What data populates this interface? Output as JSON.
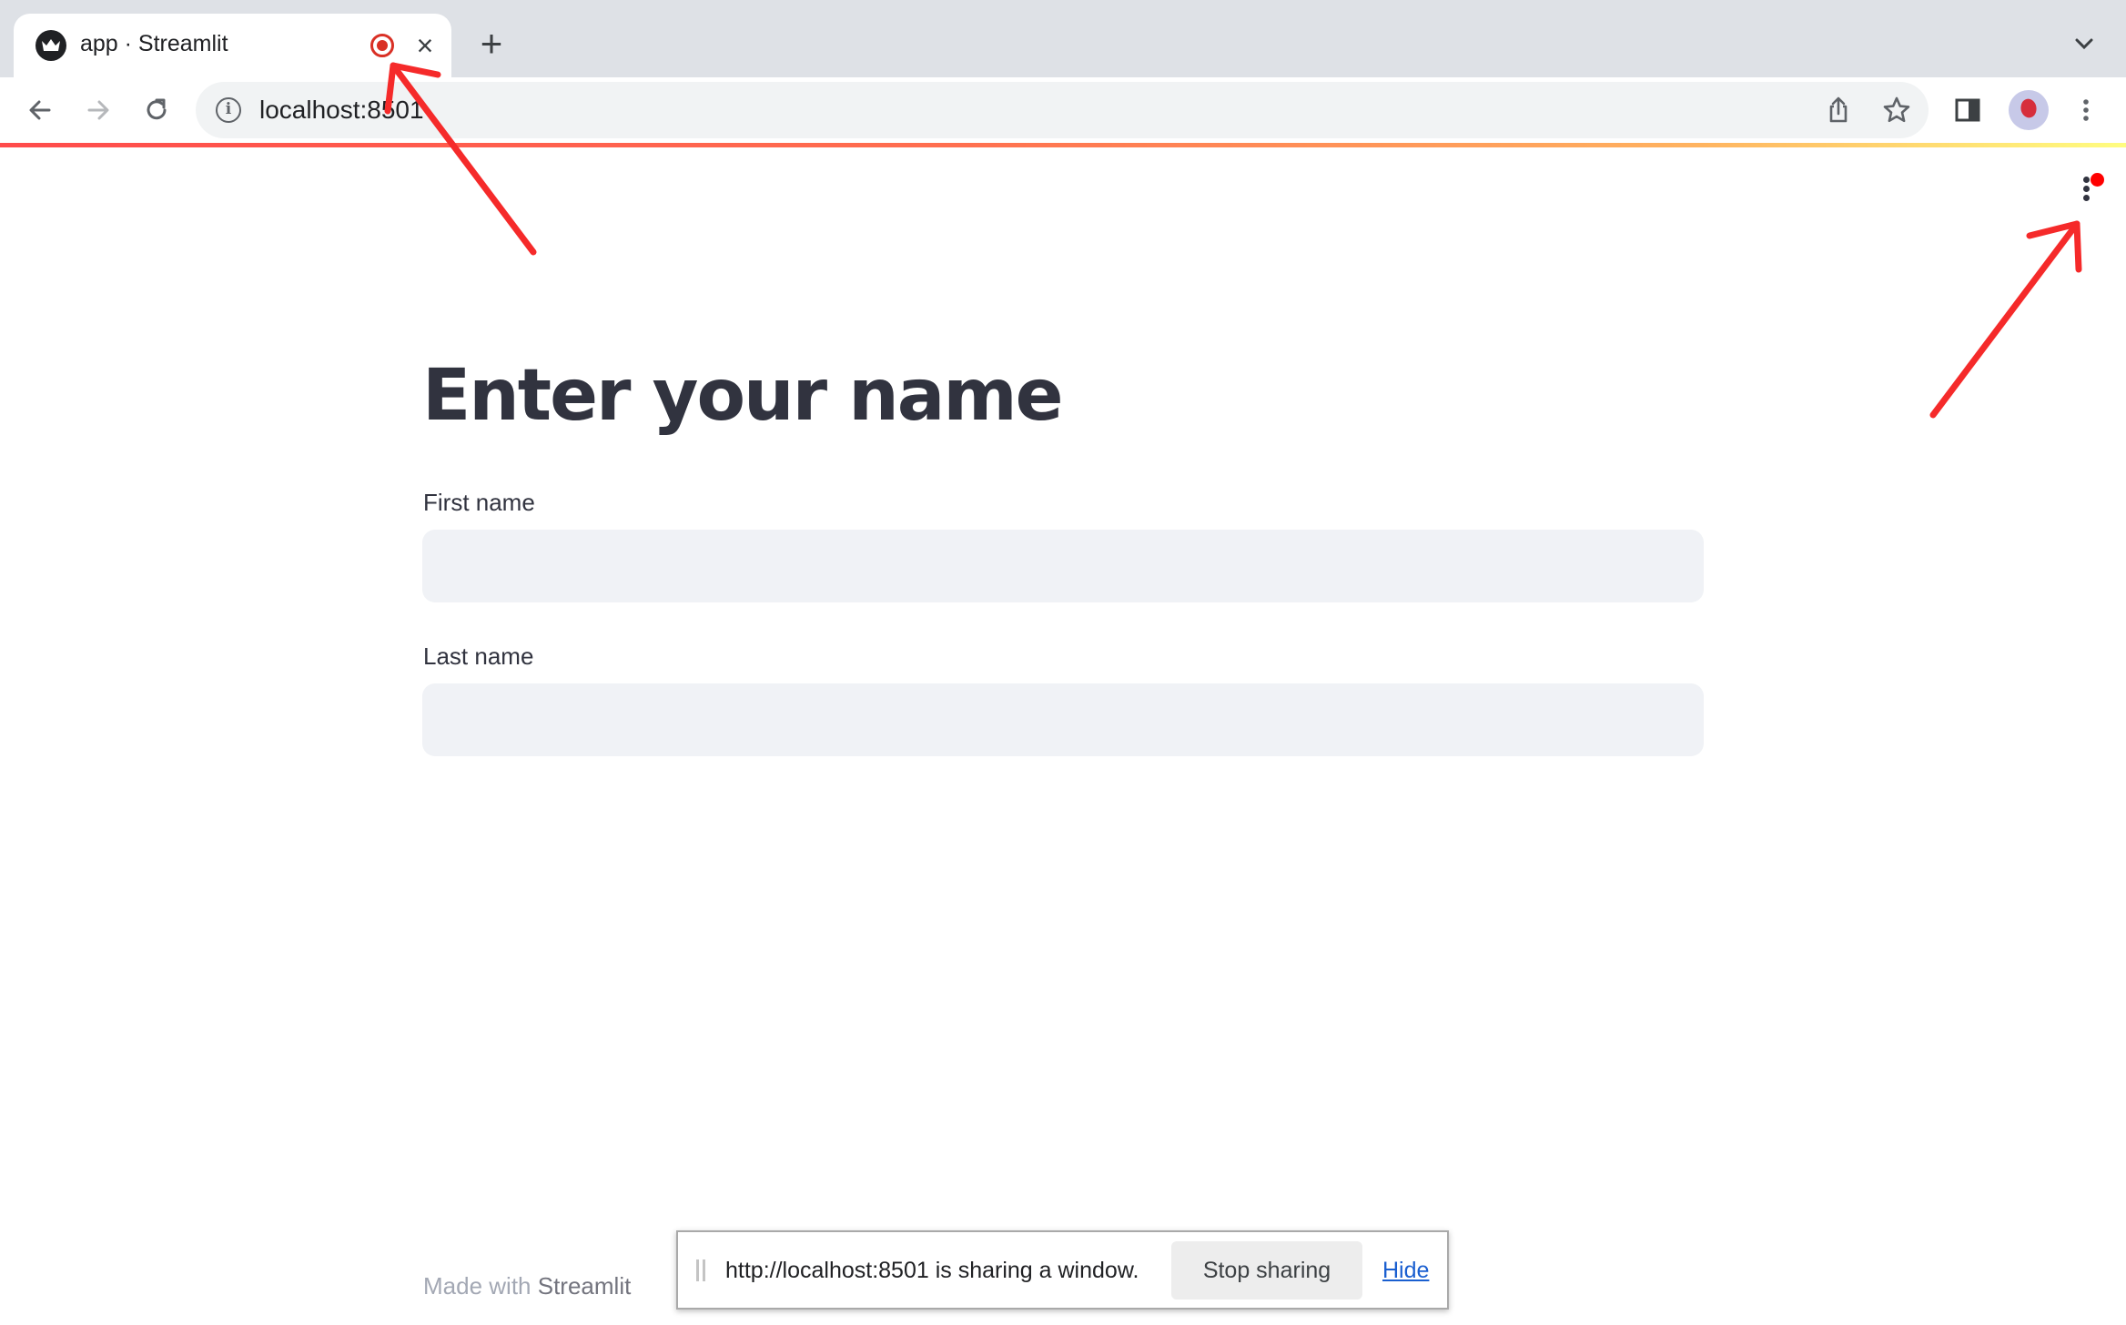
{
  "browser": {
    "tab": {
      "title": "app · Streamlit",
      "favicon": "streamlit-crown-icon",
      "recording_indicator": "recording-icon",
      "close_icon": "close-icon"
    },
    "new_tab_icon": "plus-icon",
    "tab_list_icon": "chevron-down-icon",
    "toolbar": {
      "back_icon": "arrow-left-icon",
      "forward_icon": "arrow-right-icon",
      "reload_icon": "reload-icon",
      "site_info_icon": "info-icon",
      "url": "localhost:8501",
      "share_icon": "share-icon",
      "bookmark_icon": "star-icon",
      "side_panel_icon": "side-panel-icon",
      "profile_icon": "profile-avatar",
      "menu_icon": "kebab-menu-icon"
    },
    "loading_gradient": [
      "#ff4b4b",
      "#ffb460",
      "#fffd80"
    ]
  },
  "app": {
    "menu_icon": "kebab-menu-icon",
    "menu_notification_color": "#ff0000",
    "title": "Enter your name",
    "fields": [
      {
        "label": "First name",
        "value": "",
        "placeholder": ""
      },
      {
        "label": "Last name",
        "value": "",
        "placeholder": ""
      }
    ],
    "footer": {
      "prefix": "Made with ",
      "brand": "Streamlit"
    }
  },
  "sharing_bar": {
    "message": "http://localhost:8501 is sharing a window.",
    "stop_label": "Stop sharing",
    "hide_label": "Hide"
  },
  "annotations": {
    "arrow_color": "#f52a2a",
    "arrows": [
      "points-to-tab-recording-indicator",
      "points-to-app-menu-notification"
    ]
  },
  "colors": {
    "text": "#31333f",
    "input_bg": "#f0f2f6",
    "recording_red": "#d93025",
    "link_blue": "#1a5fd0"
  }
}
